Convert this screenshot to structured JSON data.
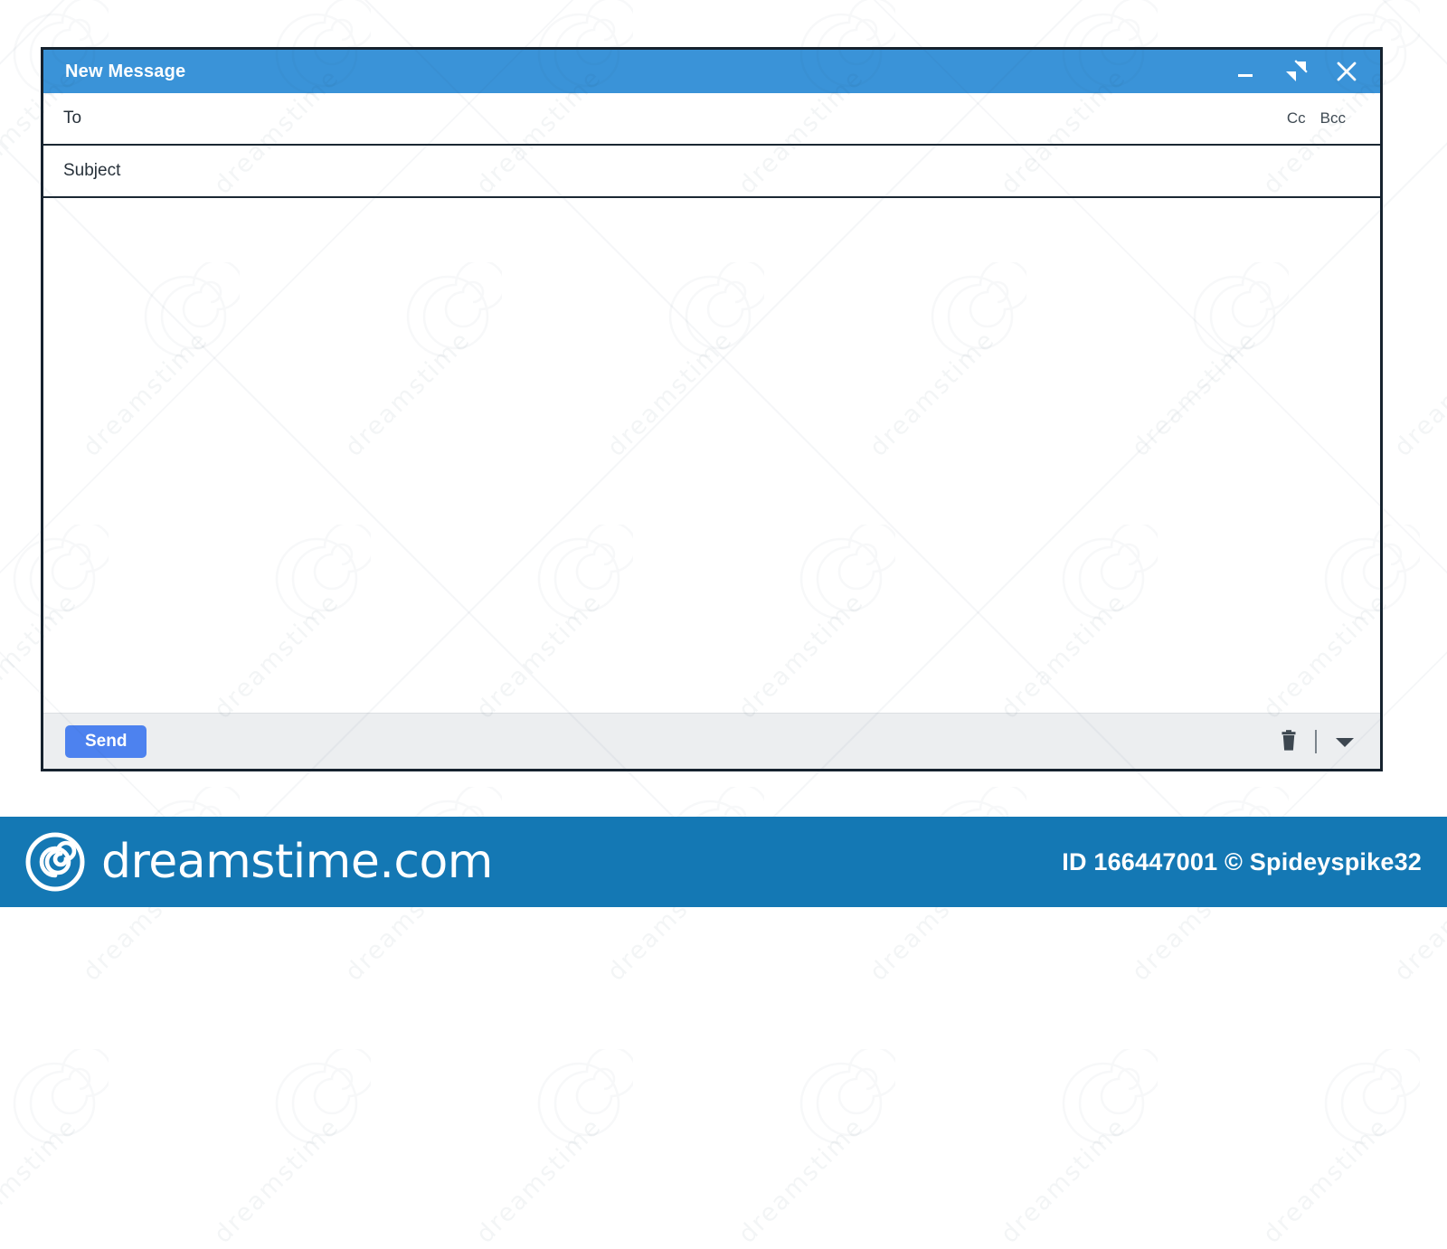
{
  "window": {
    "title": "New Message",
    "titlebar_color": "#3a93d8",
    "controls": [
      {
        "name": "minimize",
        "glyph": "minimize-icon",
        "label": "Minimize"
      },
      {
        "name": "fullscreen",
        "glyph": "fullscreen-expand-icon",
        "label": "Full screen"
      },
      {
        "name": "close",
        "glyph": "close-icon",
        "label": "Close"
      }
    ]
  },
  "fields": {
    "to": {
      "label": "To",
      "value": "",
      "placeholder": "To"
    },
    "cc": {
      "label": "Cc"
    },
    "bcc": {
      "label": "Bcc"
    },
    "subject": {
      "label": "Subject",
      "value": "",
      "placeholder": "Subject"
    },
    "body": {
      "value": "",
      "placeholder": ""
    }
  },
  "footer": {
    "send_label": "Send",
    "send_color": "#4d82ef",
    "discard_icon": "trash-icon",
    "more_options_icon": "chevron-down-icon",
    "background": "#eceef0"
  },
  "watermark": {
    "brand": "dreamstime.com",
    "logo_icon": "spiral-logo-icon",
    "credit": "ID 166447001 © Spideyspike32",
    "bar_color": "#1478b4",
    "tile_text": "dreamstime"
  }
}
